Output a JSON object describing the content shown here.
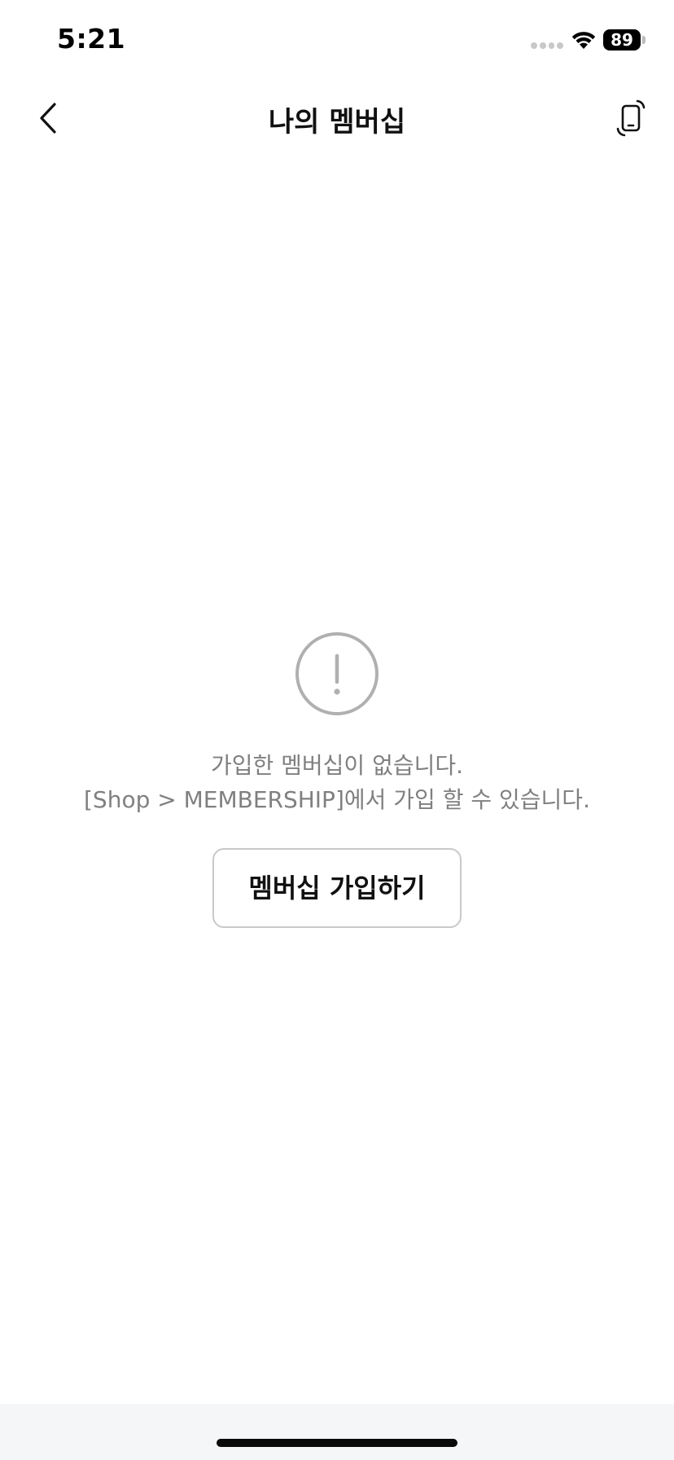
{
  "status_bar": {
    "time": "5:21",
    "battery_level": "89",
    "wifi_icon": "wifi-icon",
    "signal_icon": "cellular-signal-icon"
  },
  "nav": {
    "title": "나의 멤버십",
    "back_icon": "chevron-left-icon",
    "right_icon": "phone-rotate-icon"
  },
  "empty_state": {
    "icon": "exclamation-circle-icon",
    "line1": "가입한 멤버십이 없습니다.",
    "line2": "[Shop > MEMBERSHIP]에서 가입 할 수 있습니다.",
    "button_label": "멤버십 가입하기"
  },
  "colors": {
    "message_text": "#808080",
    "icon_gray": "#b0b0b0",
    "button_border": "#c9c9c9",
    "home_area_bg": "#f5f6f7"
  }
}
